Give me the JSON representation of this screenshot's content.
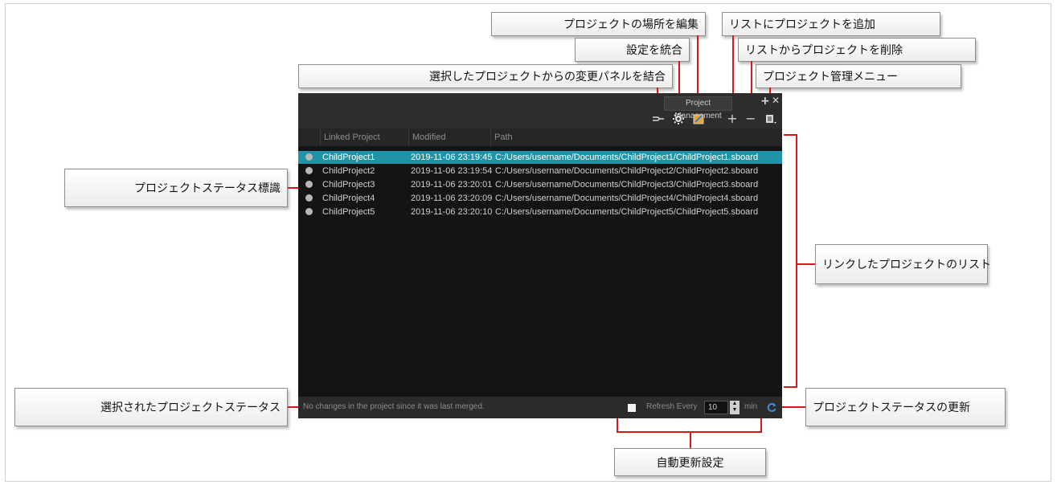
{
  "callouts": {
    "edit_location": "プロジェクトの場所を編集",
    "add_project": "リストにプロジェクトを追加",
    "merge_settings": "設定を統合",
    "remove_project": "リストからプロジェクトを削除",
    "merge_panels": "選択したプロジェクトからの変更パネルを結合",
    "management_menu": "プロジェクト管理メニュー",
    "status_indicator": "プロジェクトステータス標識",
    "linked_list": "リンクしたプロジェクトのリスト",
    "selected_status": "選択されたプロジェクトステータス",
    "refresh_status": "プロジェクトステータスの更新",
    "auto_refresh": "自動更新設定"
  },
  "panel": {
    "tab_title": "Project Management",
    "columns": [
      "Linked Project",
      "Modified",
      "Path"
    ],
    "rows": [
      {
        "name": "ChildProject1",
        "modified": "2019-11-06 23:19:45",
        "path": "C:/Users/username/Documents/ChildProject1/ChildProject1.sboard"
      },
      {
        "name": "ChildProject2",
        "modified": "2019-11-06 23:19:54",
        "path": "C:/Users/username/Documents/ChildProject2/ChildProject2.sboard"
      },
      {
        "name": "ChildProject3",
        "modified": "2019-11-06 23:20:01",
        "path": "C:/Users/username/Documents/ChildProject3/ChildProject3.sboard"
      },
      {
        "name": "ChildProject4",
        "modified": "2019-11-06 23:20:09",
        "path": "C:/Users/username/Documents/ChildProject4/ChildProject4.sboard"
      },
      {
        "name": "ChildProject5",
        "modified": "2019-11-06 23:20:10",
        "path": "C:/Users/username/Documents/ChildProject5/ChildProject5.sboard"
      }
    ],
    "status_text": "No changes in the project since it was last merged.",
    "refresh_label": "Refresh Every",
    "refresh_value": "10",
    "refresh_unit": "min"
  },
  "colors": {
    "accent": "#d9161c",
    "selection": "#1f93a8",
    "panel_bg": "#141414"
  },
  "icons": [
    "merge-panels-icon",
    "merge-settings-icon",
    "edit-location-icon",
    "add-icon",
    "remove-icon",
    "menu-icon",
    "refresh-icon"
  ]
}
